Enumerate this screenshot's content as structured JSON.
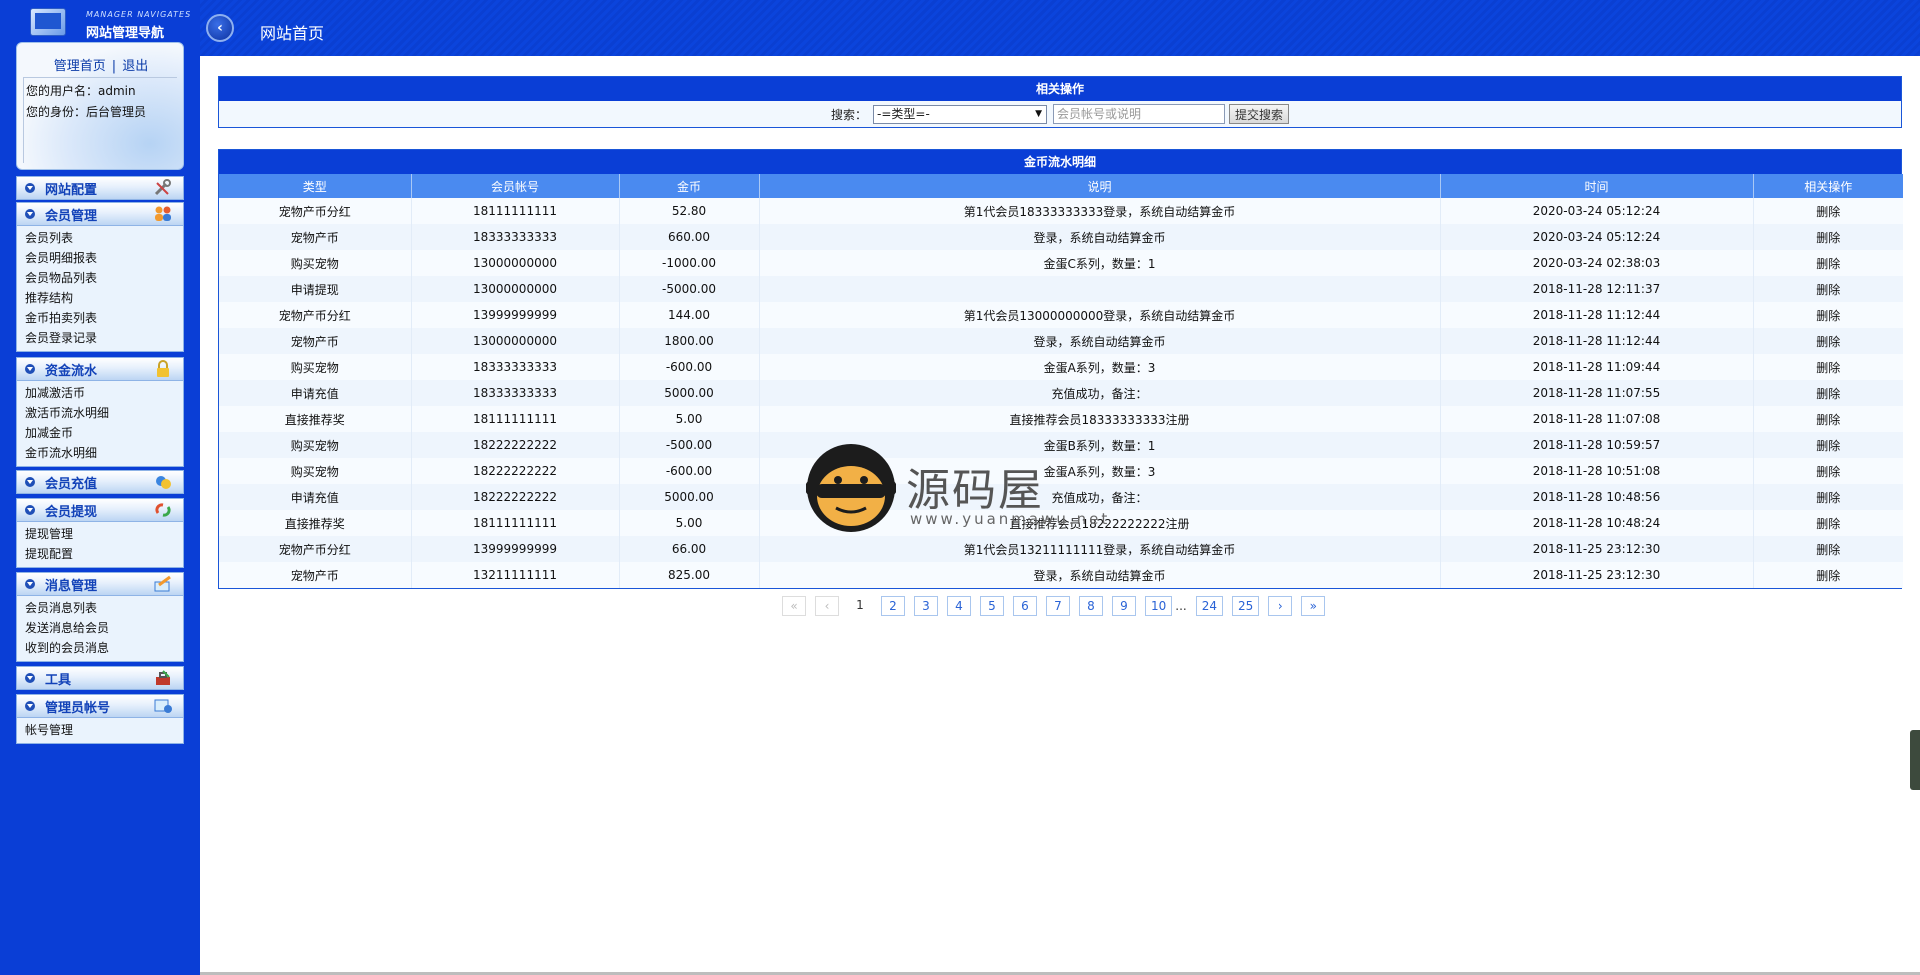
{
  "sidebar": {
    "logo_en": "MANAGER NAVIGATES",
    "logo_cn": "网站管理导航",
    "links": {
      "home": "管理首页",
      "sep": "|",
      "logout": "退出"
    },
    "user": {
      "name_line": "您的用户名：admin",
      "role_line": "您的身份：后台管理员"
    },
    "menus": [
      {
        "title": "网站配置",
        "icon": "tools-icon",
        "items": []
      },
      {
        "title": "会员管理",
        "icon": "users-icon",
        "items": [
          "会员列表",
          "会员明细报表",
          "会员物品列表",
          "推荐结构",
          "金币拍卖列表",
          "会员登录记录"
        ]
      },
      {
        "title": "资金流水",
        "icon": "lock-icon",
        "items": [
          "加减激活币",
          "激活币流水明细",
          "加减金币",
          "金币流水明细"
        ]
      },
      {
        "title": "会员充值",
        "icon": "coins-icon",
        "items": []
      },
      {
        "title": "会员提现",
        "icon": "refresh-icon",
        "items": [
          "提现管理",
          "提现配置"
        ]
      },
      {
        "title": "消息管理",
        "icon": "message-icon",
        "items": [
          "会员消息列表",
          "发送消息给会员",
          "收到的会员消息"
        ]
      },
      {
        "title": "工具",
        "icon": "toolbox-icon",
        "items": []
      },
      {
        "title": "管理员帐号",
        "icon": "admin-icon",
        "items": [
          "帐号管理"
        ]
      }
    ]
  },
  "header": {
    "title": "网站首页"
  },
  "search_panel": {
    "title": "相关操作",
    "label": "搜索：",
    "select_value": "-=类型=-",
    "input_placeholder": "会员帐号或说明",
    "button": "提交搜索"
  },
  "ledger": {
    "title": "金币流水明细",
    "columns": [
      "类型",
      "会员帐号",
      "金币",
      "说明",
      "时间",
      "相关操作"
    ],
    "rows": [
      [
        "宠物产币分红",
        "18111111111",
        "52.80",
        "第1代会员18333333333登录，系统自动结算金币",
        "2020-03-24 05:12:24",
        "删除"
      ],
      [
        "宠物产币",
        "18333333333",
        "660.00",
        "登录，系统自动结算金币",
        "2020-03-24 05:12:24",
        "删除"
      ],
      [
        "购买宠物",
        "13000000000",
        "-1000.00",
        "金蛋C系列，数量：1",
        "2020-03-24 02:38:03",
        "删除"
      ],
      [
        "申请提现",
        "13000000000",
        "-5000.00",
        "",
        "2018-11-28 12:11:37",
        "删除"
      ],
      [
        "宠物产币分红",
        "13999999999",
        "144.00",
        "第1代会员13000000000登录，系统自动结算金币",
        "2018-11-28 11:12:44",
        "删除"
      ],
      [
        "宠物产币",
        "13000000000",
        "1800.00",
        "登录，系统自动结算金币",
        "2018-11-28 11:12:44",
        "删除"
      ],
      [
        "购买宠物",
        "18333333333",
        "-600.00",
        "金蛋A系列，数量：3",
        "2018-11-28 11:09:44",
        "删除"
      ],
      [
        "申请充值",
        "18333333333",
        "5000.00",
        "充值成功，备注：",
        "2018-11-28 11:07:55",
        "删除"
      ],
      [
        "直接推荐奖",
        "18111111111",
        "5.00",
        "直接推荐会员18333333333注册",
        "2018-11-28 11:07:08",
        "删除"
      ],
      [
        "购买宠物",
        "18222222222",
        "-500.00",
        "金蛋B系列，数量：1",
        "2018-11-28 10:59:57",
        "删除"
      ],
      [
        "购买宠物",
        "18222222222",
        "-600.00",
        "金蛋A系列，数量：3",
        "2018-11-28 10:51:08",
        "删除"
      ],
      [
        "申请充值",
        "18222222222",
        "5000.00",
        "充值成功，备注：",
        "2018-11-28 10:48:56",
        "删除"
      ],
      [
        "直接推荐奖",
        "18111111111",
        "5.00",
        "直接推荐会员18222222222注册",
        "2018-11-28 10:48:24",
        "删除"
      ],
      [
        "宠物产币分红",
        "13999999999",
        "66.00",
        "第1代会员13211111111登录，系统自动结算金币",
        "2018-11-25 23:12:30",
        "删除"
      ],
      [
        "宠物产币",
        "13211111111",
        "825.00",
        "登录，系统自动结算金币",
        "2018-11-25 23:12:30",
        "删除"
      ]
    ]
  },
  "pagination": {
    "first": "«",
    "prev": "‹",
    "current": "1",
    "pages": [
      "2",
      "3",
      "4",
      "5",
      "6",
      "7",
      "8",
      "9",
      "10"
    ],
    "ellipsis": "...",
    "tail_pages": [
      "24",
      "25"
    ],
    "next": "›",
    "last": "»"
  },
  "watermark": {
    "brand": "源码屋",
    "url": "www.yuanmawu.net"
  },
  "colors": {
    "nav_blue": "#0a3ed6",
    "header_blue": "#4a8af0",
    "panel_bg": "#f2f8fe"
  }
}
